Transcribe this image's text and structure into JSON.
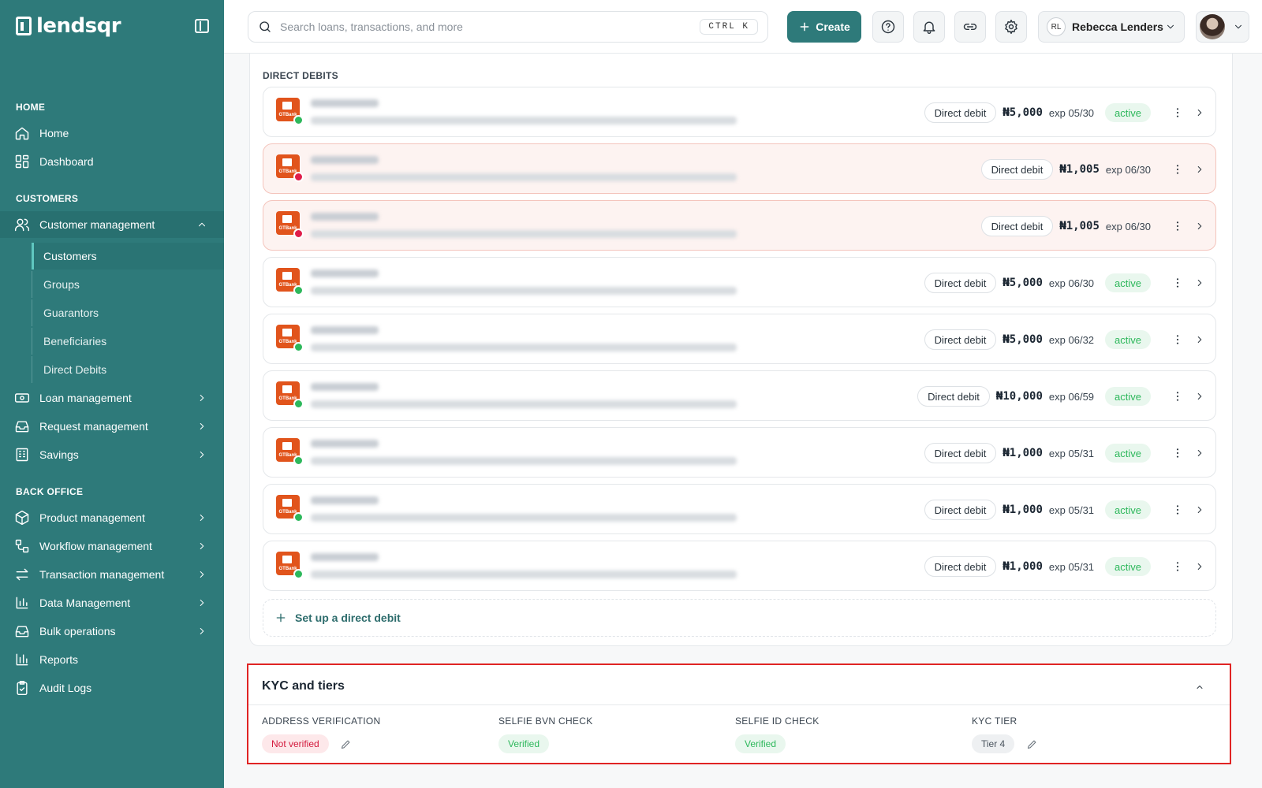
{
  "brand": {
    "logo_text": "lendsqr"
  },
  "sidebar": {
    "sections": {
      "home": "HOME",
      "customers": "CUSTOMERS",
      "back_office": "BACK OFFICE"
    },
    "items": {
      "home": "Home",
      "dashboard": "Dashboard",
      "customer_management": "Customer management",
      "customers": "Customers",
      "groups": "Groups",
      "guarantors": "Guarantors",
      "beneficiaries": "Beneficiaries",
      "direct_debits": "Direct Debits",
      "loan_management": "Loan management",
      "request_management": "Request management",
      "savings": "Savings",
      "product_management": "Product management",
      "workflow_management": "Workflow management",
      "transaction_management": "Transaction management",
      "data_management": "Data Management",
      "bulk_operations": "Bulk operations",
      "reports": "Reports",
      "audit_logs": "Audit Logs"
    }
  },
  "topbar": {
    "search_placeholder": "Search loans, transactions, and more",
    "shortcut": "CTRL K",
    "create_label": "Create",
    "org_initials": "RL",
    "org_name": "Rebecca Lenders"
  },
  "direct_debits": {
    "section_label": "DIRECT DEBITS",
    "bank_logo_text": "GTBank",
    "type_label": "Direct debit",
    "active_label": "active",
    "rows": [
      {
        "amount": "₦5,000",
        "expiry": "exp 05/30",
        "status": "active"
      },
      {
        "amount": "₦1,005",
        "expiry": "exp 06/30",
        "status": "failed"
      },
      {
        "amount": "₦1,005",
        "expiry": "exp 06/30",
        "status": "failed"
      },
      {
        "amount": "₦5,000",
        "expiry": "exp 06/30",
        "status": "active"
      },
      {
        "amount": "₦5,000",
        "expiry": "exp 06/32",
        "status": "active"
      },
      {
        "amount": "₦10,000",
        "expiry": "exp 06/59",
        "status": "active"
      },
      {
        "amount": "₦1,000",
        "expiry": "exp 05/31",
        "status": "active"
      },
      {
        "amount": "₦1,000",
        "expiry": "exp 05/31",
        "status": "active"
      },
      {
        "amount": "₦1,000",
        "expiry": "exp 05/31",
        "status": "active"
      }
    ],
    "setup_label": "Set up a direct debit"
  },
  "kyc": {
    "title": "KYC and tiers",
    "address_verification": {
      "label": "ADDRESS VERIFICATION",
      "value": "Not verified"
    },
    "selfie_bvn": {
      "label": "SELFIE BVN CHECK",
      "value": "Verified"
    },
    "selfie_id": {
      "label": "SELFIE ID CHECK",
      "value": "Verified"
    },
    "kyc_tier": {
      "label": "KYC TIER",
      "value": "Tier 4"
    }
  },
  "colors": {
    "sidebar_bg": "#2e7a7a",
    "accent": "#2e7a7a",
    "active_green": "#2eb85c",
    "failed_red": "#e01e4a",
    "highlight_border": "#e02424"
  }
}
